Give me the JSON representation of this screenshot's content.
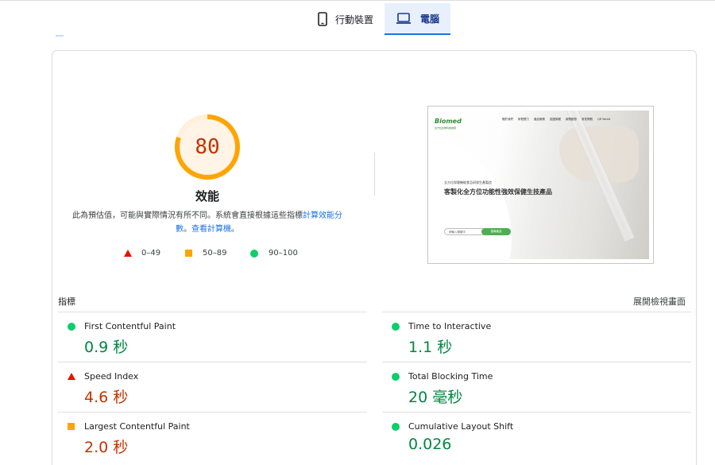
{
  "tabs": [
    {
      "label": "行動裝置",
      "icon": "phone-icon",
      "active": false
    },
    {
      "label": "電腦",
      "icon": "laptop-icon",
      "active": true
    }
  ],
  "score": {
    "value": "80",
    "fraction": 0.8,
    "title": "效能",
    "ring_color": "#ffa400",
    "track_color": "#fff3e0"
  },
  "description": {
    "text": "此為預估值，可能與實際情況有所不同。系統會直接根據這些指標",
    "link1": "計算效能分數",
    "sep": "。",
    "link2": "查看計算機",
    "end": "。"
  },
  "legend": [
    {
      "label": "0–49",
      "shape": "triangle",
      "color": "#eb0f00"
    },
    {
      "label": "50–89",
      "shape": "square",
      "color": "#ffa400"
    },
    {
      "label": "90–100",
      "shape": "circle",
      "color": "#0cce6b"
    }
  ],
  "screenshot_page": {
    "logo": "Biomed",
    "logo_sub": "全方位生物科技健康",
    "nav": [
      "關於我們",
      "研發實力",
      "產品服務",
      "認證榮耀",
      "新聞動態",
      "常見問題",
      "QR World"
    ],
    "tagline": "全方位保健機能食品研發生產製造",
    "headline": "客製化全方位功能性強效保健生技產品",
    "input_placeholder": "請輸入關鍵字",
    "button": "搜尋產品"
  },
  "metrics": {
    "header": "指標",
    "expand_label": "展開檢視畫面",
    "items": [
      {
        "name": "First Contentful Paint",
        "value": "0.9 秒",
        "rating": "good"
      },
      {
        "name": "Time to Interactive",
        "value": "1.1 秒",
        "rating": "good"
      },
      {
        "name": "Speed Index",
        "value": "4.6 秒",
        "rating": "bad"
      },
      {
        "name": "Total Blocking Time",
        "value": "20 毫秒",
        "rating": "good"
      },
      {
        "name": "Largest Contentful Paint",
        "value": "2.0 秒",
        "rating": "bad"
      },
      {
        "name": "Cumulative Layout Shift",
        "value": "0.026",
        "rating": "good"
      }
    ]
  }
}
